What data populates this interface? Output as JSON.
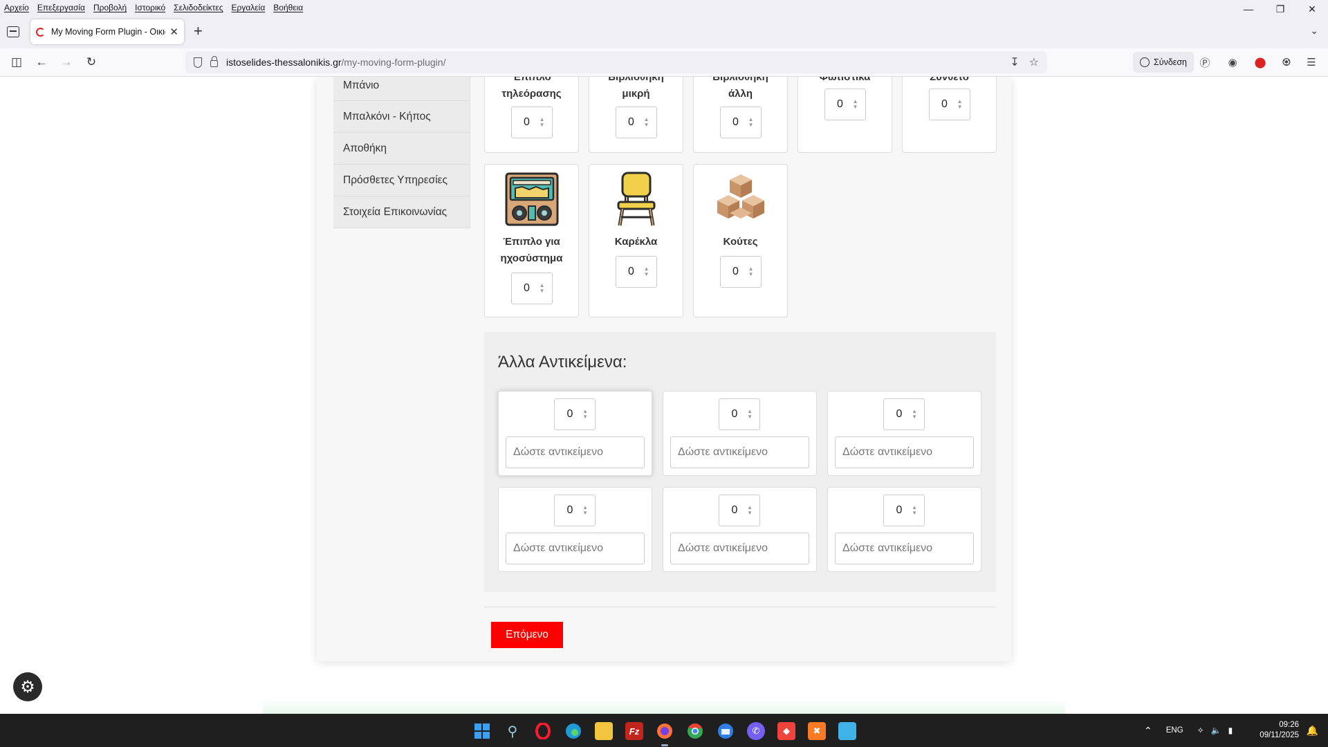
{
  "browser": {
    "menu": [
      "Αρχείο",
      "Επεξεργασία",
      "Προβολή",
      "Ιστορικό",
      "Σελιδοδείκτες",
      "Εργαλεία",
      "Βοήθεια"
    ],
    "tab_title": "My Moving Form Plugin - Οικια",
    "url_host": "istoselides-thessalonikis.gr",
    "url_path": "/my-moving-form-plugin/",
    "signin_label": "Σύνδεση"
  },
  "sidebar": {
    "items": [
      "Μπάνιο",
      "Μπαλκόνι - Κήπος",
      "Αποθήκη",
      "Πρόσθετες Υπηρεσίες",
      "Στοιχεία Επικοινωνίας"
    ]
  },
  "top_items": [
    {
      "label": "Έπιπλο τηλεόρασης",
      "qty": "0"
    },
    {
      "label": "Βιβλιοθήκη μικρή",
      "qty": "0"
    },
    {
      "label": "Βιβλιοθήκη άλλη",
      "qty": "0"
    },
    {
      "label": "Φωτιστικά",
      "qty": "0"
    },
    {
      "label": "Σύνθετο",
      "qty": "0"
    }
  ],
  "items": [
    {
      "label": "Έπιπλο για ηχοσύστημα",
      "qty": "0",
      "icon": "stereo-cabinet-icon"
    },
    {
      "label": "Καρέκλα",
      "qty": "0",
      "icon": "chair-icon"
    },
    {
      "label": "Κούτες",
      "qty": "0",
      "icon": "boxes-icon"
    }
  ],
  "other_items": {
    "title": "Άλλα Αντικείμενα:",
    "placeholder": "Δώστε αντικείμενο",
    "qty": [
      "0",
      "0",
      "0",
      "0",
      "0",
      "0"
    ]
  },
  "next_label": "Επόμενο",
  "taskbar": {
    "lang": "ENG",
    "time": "09:26",
    "date": "09/11/2025"
  },
  "colors": {
    "accent": "#ff0000",
    "taskbar": "#1f1f1f"
  }
}
